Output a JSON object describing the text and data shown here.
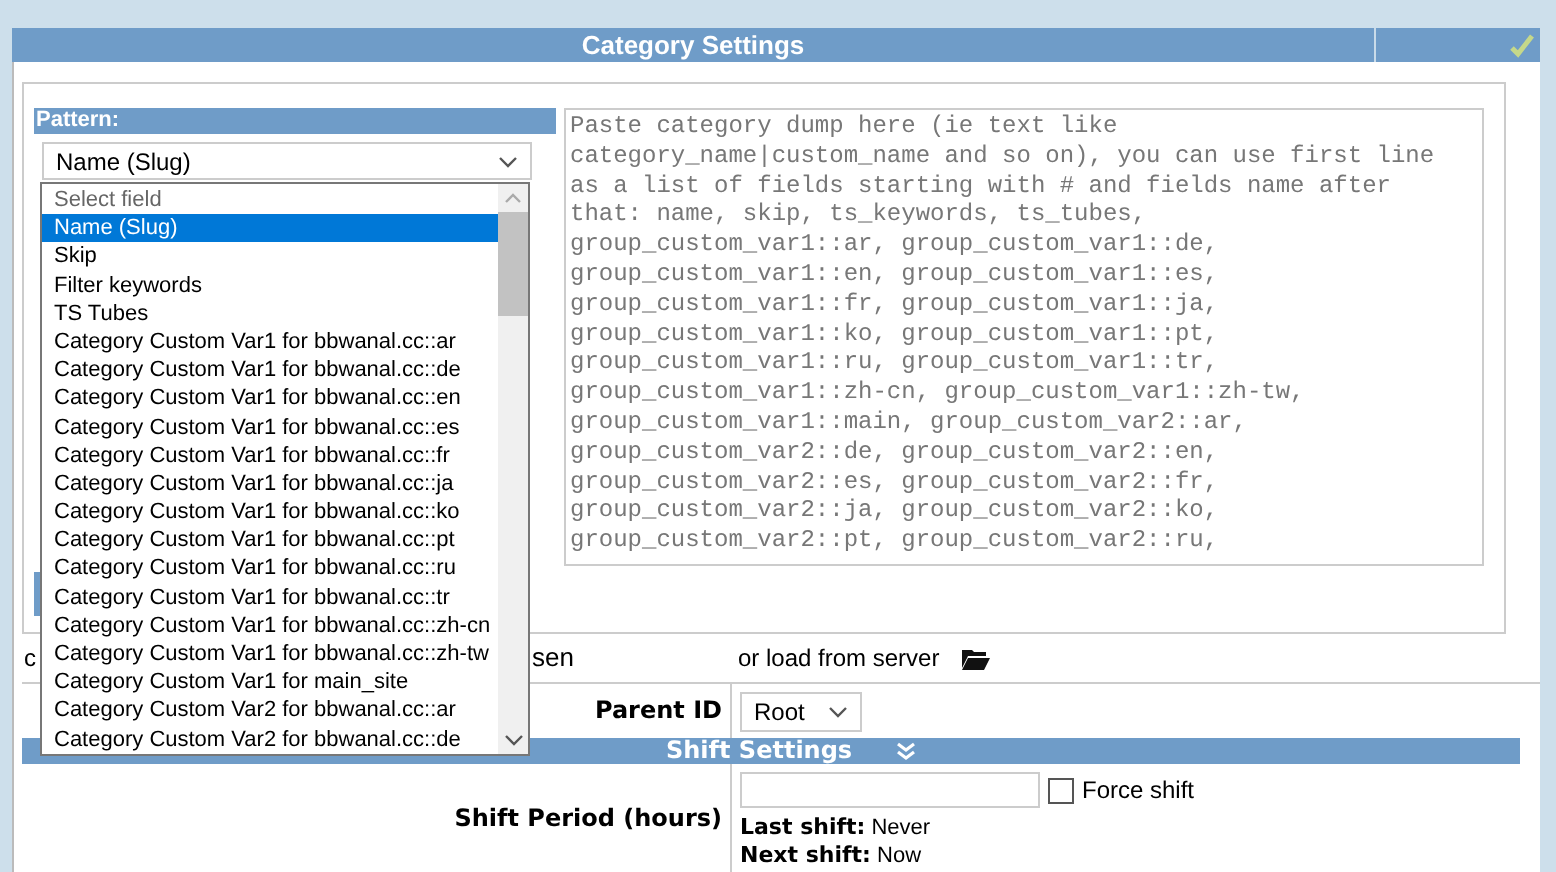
{
  "header": {
    "title": "Category Settings"
  },
  "pattern": {
    "label": "Pattern:",
    "value": "Name (Slug)",
    "expanded": true,
    "options": [
      {
        "label": "Select field",
        "kind": "placeholder",
        "selected": false
      },
      {
        "label": "Name (Slug)",
        "kind": "option",
        "selected": true
      },
      {
        "label": "Skip",
        "kind": "option",
        "selected": false
      },
      {
        "label": "Filter keywords",
        "kind": "option",
        "selected": false
      },
      {
        "label": "TS Tubes",
        "kind": "option",
        "selected": false
      },
      {
        "label": "Category Custom Var1 for bbwanal.cc::ar",
        "kind": "option",
        "selected": false
      },
      {
        "label": "Category Custom Var1 for bbwanal.cc::de",
        "kind": "option",
        "selected": false
      },
      {
        "label": "Category Custom Var1 for bbwanal.cc::en",
        "kind": "option",
        "selected": false
      },
      {
        "label": "Category Custom Var1 for bbwanal.cc::es",
        "kind": "option",
        "selected": false
      },
      {
        "label": "Category Custom Var1 for bbwanal.cc::fr",
        "kind": "option",
        "selected": false
      },
      {
        "label": "Category Custom Var1 for bbwanal.cc::ja",
        "kind": "option",
        "selected": false
      },
      {
        "label": "Category Custom Var1 for bbwanal.cc::ko",
        "kind": "option",
        "selected": false
      },
      {
        "label": "Category Custom Var1 for bbwanal.cc::pt",
        "kind": "option",
        "selected": false
      },
      {
        "label": "Category Custom Var1 for bbwanal.cc::ru",
        "kind": "option",
        "selected": false
      },
      {
        "label": "Category Custom Var1 for bbwanal.cc::tr",
        "kind": "option",
        "selected": false
      },
      {
        "label": "Category Custom Var1 for bbwanal.cc::zh-cn",
        "kind": "option",
        "selected": false
      },
      {
        "label": "Category Custom Var1 for bbwanal.cc::zh-tw",
        "kind": "option",
        "selected": false
      },
      {
        "label": "Category Custom Var1 for main_site",
        "kind": "option",
        "selected": false
      },
      {
        "label": "Category Custom Var2 for bbwanal.cc::ar",
        "kind": "option",
        "selected": false
      },
      {
        "label": "Category Custom Var2 for bbwanal.cc::de",
        "kind": "option",
        "selected": false
      }
    ]
  },
  "dump": {
    "placeholder": "Paste category dump here (ie text like category_name|custom_name and so on), you can use first line as a list of fields starting with # and fields name after that: name, skip, ts_keywords, ts_tubes, group_custom_var1::ar, group_custom_var1::de, group_custom_var1::en, group_custom_var1::es, group_custom_var1::fr, group_custom_var1::ja, group_custom_var1::ko, group_custom_var1::pt, group_custom_var1::ru, group_custom_var1::tr, group_custom_var1::zh-cn, group_custom_var1::zh-tw, group_custom_var1::main, group_custom_var2::ar, group_custom_var2::de, group_custom_var2::en, group_custom_var2::es, group_custom_var2::fr, group_custom_var2::ja, group_custom_var2::ko, group_custom_var2::pt, group_custom_var2::ru,"
  },
  "file_row": {
    "text_left": "c",
    "text_right": "sen",
    "load_text": "or load from server"
  },
  "parent": {
    "label": "Parent ID",
    "value": "Root"
  },
  "shift_section": {
    "title": "Shift Settings"
  },
  "shift": {
    "label": "Shift Period (hours)",
    "force_label": "Force shift",
    "force_checked": false,
    "last_label": "Last shift:",
    "last_value": "Never",
    "next_label": "Next shift:",
    "next_value": "Now"
  }
}
